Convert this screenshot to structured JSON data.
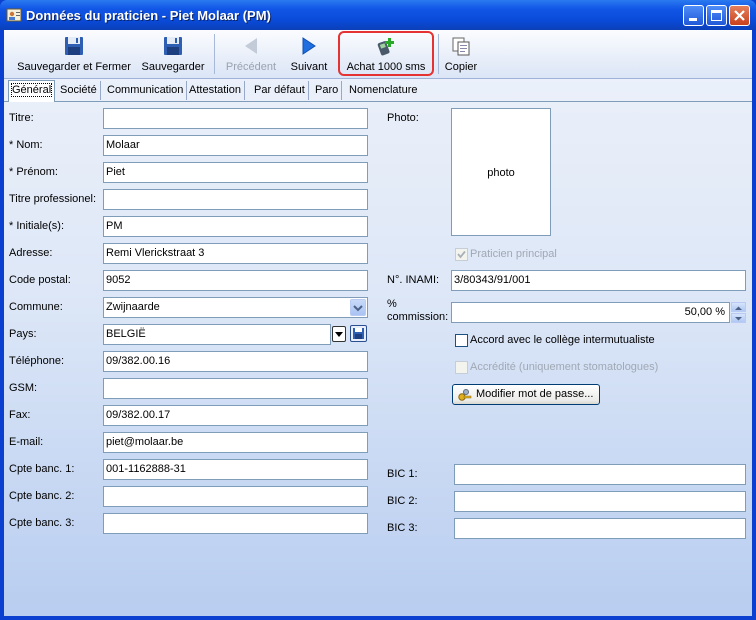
{
  "window": {
    "title": "Données du praticien - Piet Molaar (PM)",
    "controls": {
      "minimize": "minimize",
      "maximize": "maximize",
      "close": "close"
    }
  },
  "toolbar": {
    "items": [
      {
        "label": "Sauvegarder et Fermer",
        "icon": "floppy-disk-icon",
        "enabled": true
      },
      {
        "label": "Sauvegarder",
        "icon": "floppy-disk-icon",
        "enabled": true
      },
      {
        "label": "Précédent",
        "icon": "arrow-left-icon",
        "enabled": false
      },
      {
        "label": "Suivant",
        "icon": "arrow-right-icon",
        "enabled": true
      },
      {
        "label": "Achat 1000 sms",
        "icon": "phone-add-icon",
        "enabled": true,
        "highlighted": true
      },
      {
        "label": "Copier",
        "icon": "copy-icon",
        "enabled": true
      }
    ]
  },
  "tabs": [
    "Général",
    "Société",
    "Communication",
    "Attestation",
    "Par défaut",
    "Paro",
    "Nomenclature"
  ],
  "form": {
    "titre": {
      "label": "Titre:",
      "value": ""
    },
    "nom": {
      "label": "* Nom:",
      "value": "Molaar"
    },
    "prenom": {
      "label": "* Prénom:",
      "value": "Piet"
    },
    "titre_prof": {
      "label": "Titre professionel:",
      "value": ""
    },
    "initiales": {
      "label": "* Initiale(s):",
      "value": "PM"
    },
    "adresse": {
      "label": "Adresse:",
      "value": "Remi Vlerickstraat 3"
    },
    "code_postal": {
      "label": "Code postal:",
      "value": "9052"
    },
    "commune": {
      "label": "Commune:",
      "value": "Zwijnaarde"
    },
    "pays": {
      "label": "Pays:",
      "value": "BELGIË"
    },
    "telephone": {
      "label": "Téléphone:",
      "value": "09/382.00.16"
    },
    "gsm": {
      "label": "GSM:",
      "value": ""
    },
    "fax": {
      "label": "Fax:",
      "value": "09/382.00.17"
    },
    "email": {
      "label": "E-mail:",
      "value": "piet@molaar.be"
    },
    "cpte1": {
      "label": "Cpte banc. 1:",
      "value": "001-1162888-31"
    },
    "cpte2": {
      "label": "Cpte banc. 2:",
      "value": ""
    },
    "cpte3": {
      "label": "Cpte banc. 3:",
      "value": ""
    }
  },
  "right": {
    "photo_label": "Photo:",
    "photo_placeholder": "photo",
    "praticien_principal": {
      "label": "Praticien principal",
      "checked": true,
      "enabled": false
    },
    "inami": {
      "label": "N°. INAMI:",
      "value": "3/80343/91/001"
    },
    "commission": {
      "label_line1": "%",
      "label_line2": "commission:",
      "value": "50,00 %"
    },
    "accord": {
      "label": "Accord avec le collège intermutualiste",
      "checked": false,
      "enabled": true
    },
    "accredite": {
      "label": "Accrédité (uniquement stomatologues)",
      "checked": false,
      "enabled": false
    },
    "modifier_btn": "Modifier mot de passe...",
    "bic1": {
      "label": "BIC 1:",
      "value": ""
    },
    "bic2": {
      "label": "BIC 2:",
      "value": ""
    },
    "bic3": {
      "label": "BIC 3:",
      "value": ""
    }
  },
  "colors": {
    "title_bar": "#0a4ad8",
    "highlight_border": "#e53333",
    "disabled_text": "#9aa2b0"
  }
}
